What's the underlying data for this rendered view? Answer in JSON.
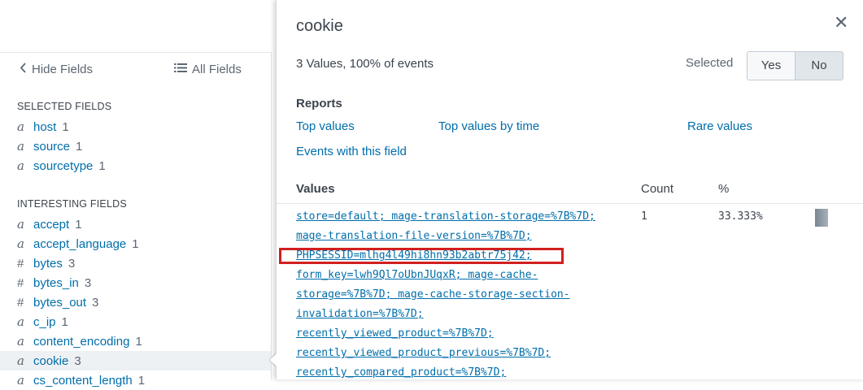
{
  "sidebar": {
    "hide_fields_label": "Hide Fields",
    "all_fields_label": "All Fields",
    "selected_heading": "SELECTED FIELDS",
    "interesting_heading": "INTERESTING FIELDS",
    "selected_fields": [
      {
        "type": "a",
        "name": "host",
        "count": "1"
      },
      {
        "type": "a",
        "name": "source",
        "count": "1"
      },
      {
        "type": "a",
        "name": "sourcetype",
        "count": "1"
      }
    ],
    "interesting_fields": [
      {
        "type": "a",
        "name": "accept",
        "count": "1"
      },
      {
        "type": "a",
        "name": "accept_language",
        "count": "1"
      },
      {
        "type": "#",
        "name": "bytes",
        "count": "3"
      },
      {
        "type": "#",
        "name": "bytes_in",
        "count": "3"
      },
      {
        "type": "#",
        "name": "bytes_out",
        "count": "3"
      },
      {
        "type": "a",
        "name": "c_ip",
        "count": "1"
      },
      {
        "type": "a",
        "name": "content_encoding",
        "count": "1"
      },
      {
        "type": "a",
        "name": "cookie",
        "count": "3"
      },
      {
        "type": "a",
        "name": "cs_content_length",
        "count": "1"
      }
    ]
  },
  "popup": {
    "title": "cookie",
    "close_glyph": "✕",
    "stats": "3 Values, 100% of events",
    "selected_label": "Selected",
    "yes_label": "Yes",
    "no_label": "No",
    "selected_value": "No",
    "reports_heading": "Reports",
    "report_links": {
      "top_values": "Top values",
      "top_values_by_time": "Top values by time",
      "rare_values": "Rare values",
      "events_with_field": "Events with this field"
    },
    "table": {
      "col_values": "Values",
      "col_count": "Count",
      "col_percent": "%",
      "rows": [
        {
          "lines": [
            "store=default; mage-translation-storage=%7B%7D;",
            "mage-translation-file-version=%7B%7D;",
            "PHPSESSID=mlhg4l49hi8hn93b2abtr75j42;",
            "form_key=lwh9Ql7oUbnJUqxR; mage-cache-",
            "storage=%7B%7D; mage-cache-storage-section-",
            "invalidation=%7B%7D;",
            "recently_viewed_product=%7B%7D;",
            "recently_viewed_product_previous=%7B%7D;",
            "recently_compared_product=%7B%7D;"
          ],
          "count": "1",
          "percent": "33.333%",
          "percent_value": 0.33333
        }
      ]
    }
  },
  "colors": {
    "link": "#006eaa",
    "highlight": "#d21f1f",
    "text": "#3c444d"
  }
}
